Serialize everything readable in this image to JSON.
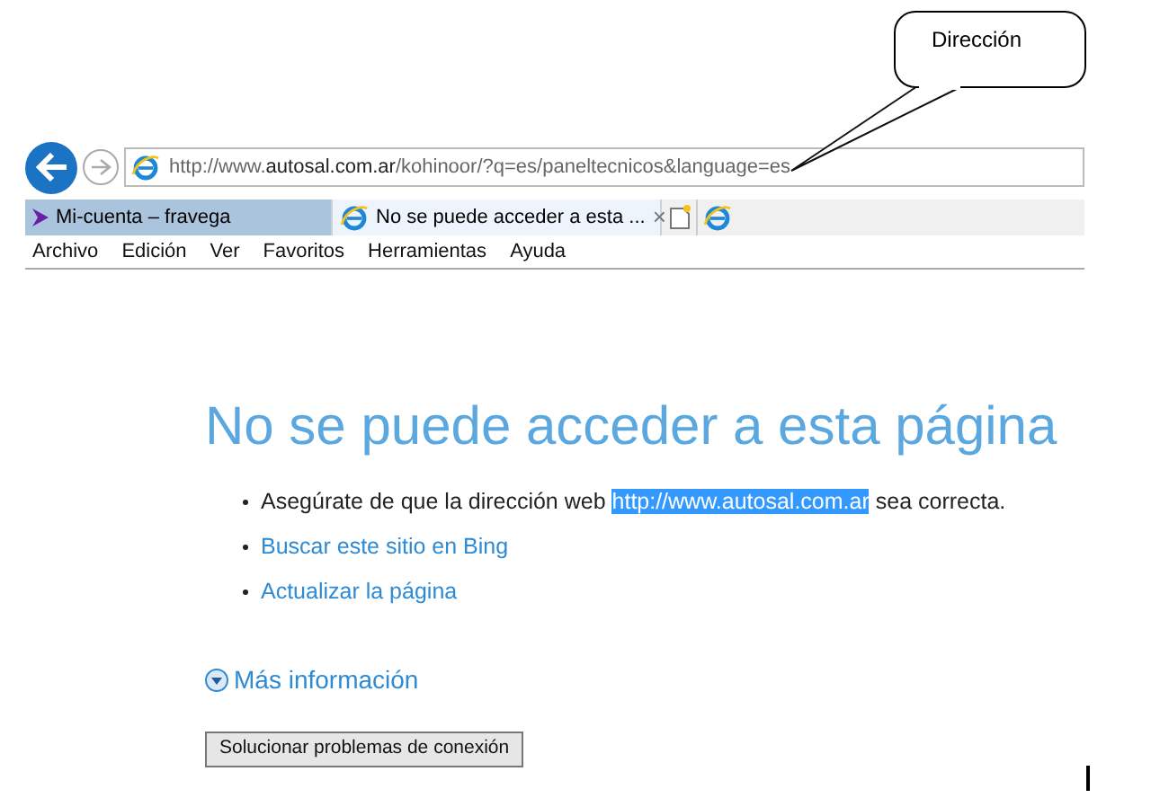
{
  "callout": {
    "text": "Dirección"
  },
  "address_bar": {
    "url": "http://www.**autosal.com.ar**/kohinoor/?q=es/paneltecnicos&language=es"
  },
  "tabs": [
    {
      "label": "Mi-cuenta – fravega",
      "selected": false
    },
    {
      "label": "No se puede acceder a esta ...",
      "selected": true,
      "close": "×"
    }
  ],
  "menu": [
    "Archivo",
    "Edición",
    "Ver",
    "Favoritos",
    "Herramientas",
    "Ayuda"
  ],
  "page": {
    "heading": "No se puede acceder a esta página",
    "items": [
      {
        "kind": "text",
        "before": "Asegúrate de que la dirección web ",
        "selected_text": "http://www.autosal.com.ar",
        "after": " sea correcta."
      },
      {
        "kind": "link",
        "text": "Buscar este sitio en Bing"
      },
      {
        "kind": "link",
        "text": "Actualizar la página"
      }
    ],
    "more_info": "Más información",
    "button": "Solucionar problemas de conexión"
  }
}
